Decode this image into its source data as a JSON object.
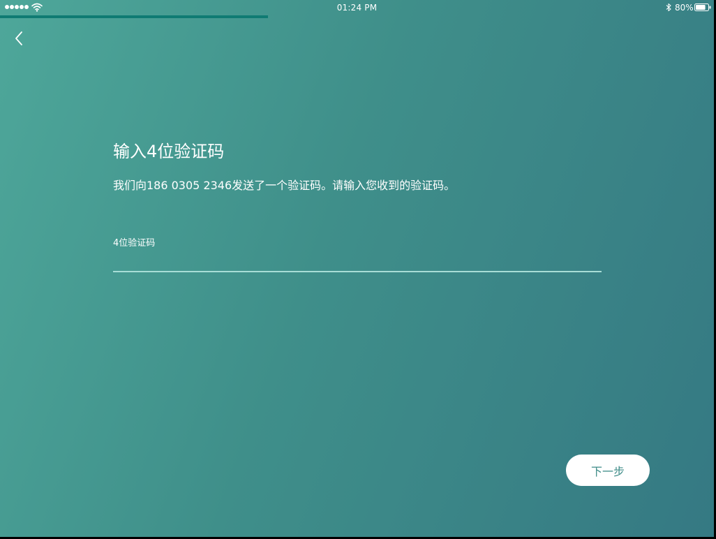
{
  "status_bar": {
    "time": "01:24 PM",
    "battery_percent": "80%",
    "battery_level": 0.8,
    "signal_bars": 5,
    "icons": [
      "wifi-icon",
      "bluetooth-icon",
      "battery-icon"
    ]
  },
  "progress": {
    "fraction": 0.375,
    "color": "#0f7b73"
  },
  "nav": {
    "back_icon": "chevron-left-icon"
  },
  "main": {
    "title": "输入4位验证码",
    "instruction": "我们向186 0305 2346发送了一个验证码。请输入您收到的验证码。",
    "code_field": {
      "label": "4位验证码",
      "value": "",
      "placeholder": ""
    },
    "next_button_label": "下一步"
  },
  "colors": {
    "background_start": "#4ea79a",
    "background_end": "#357983",
    "accent_text": "#3d8b87",
    "input_underline": "#a8ddd6"
  }
}
